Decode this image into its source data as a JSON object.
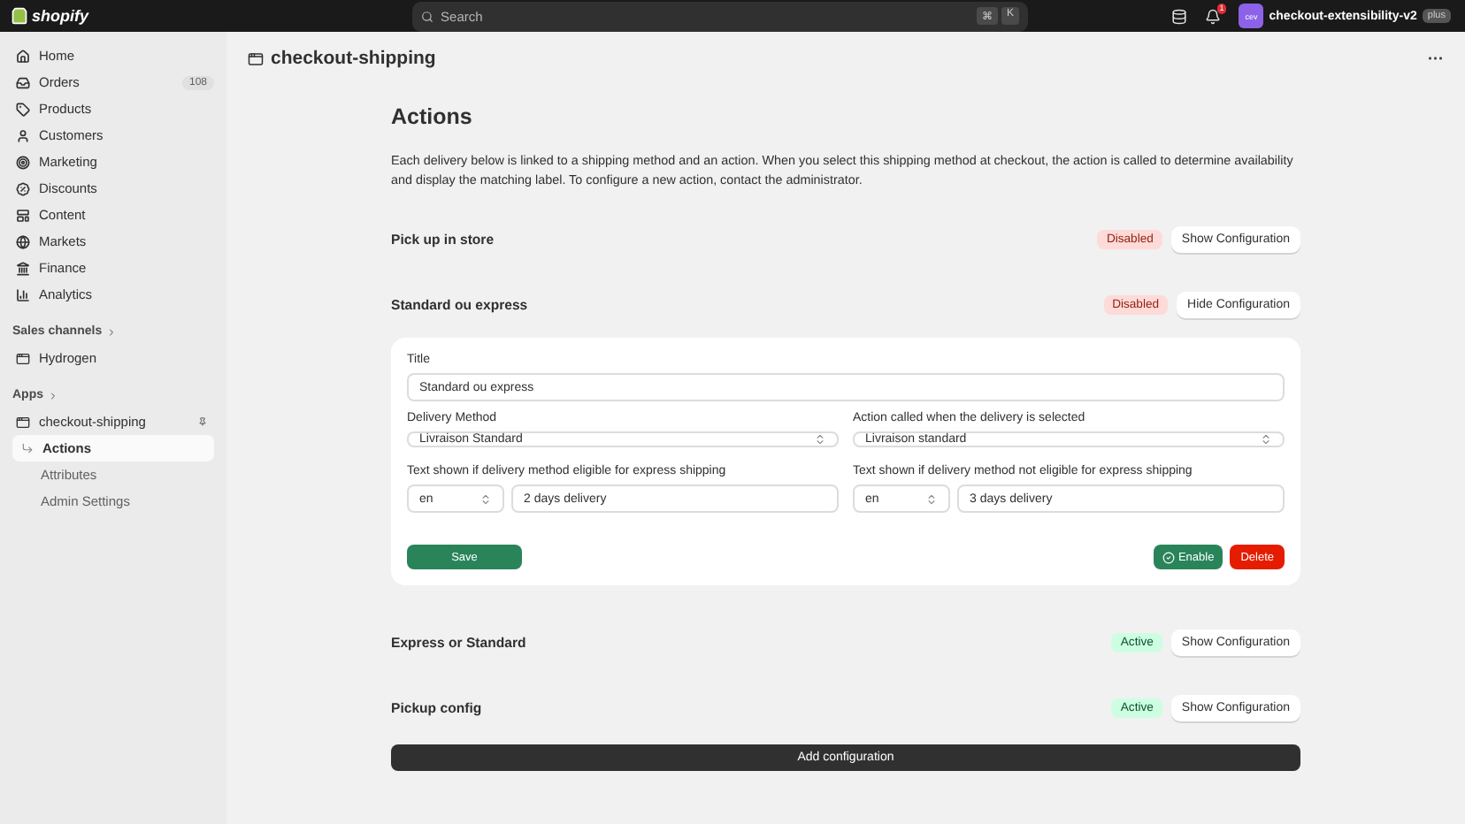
{
  "topbar": {
    "logo": "shopify",
    "search": {
      "placeholder": "Search",
      "shortcut": [
        "⌘",
        "K"
      ]
    },
    "notifications": "1",
    "store": {
      "avatar": "cev",
      "name": "checkout-extensibility-v2",
      "plan": "plus"
    }
  },
  "sidebar": {
    "items": [
      {
        "label": "Home"
      },
      {
        "label": "Orders",
        "count": "108"
      },
      {
        "label": "Products"
      },
      {
        "label": "Customers"
      },
      {
        "label": "Marketing"
      },
      {
        "label": "Discounts"
      },
      {
        "label": "Content"
      },
      {
        "label": "Markets"
      },
      {
        "label": "Finance"
      },
      {
        "label": "Analytics"
      }
    ],
    "sales_channels": {
      "heading": "Sales channels",
      "items": [
        {
          "label": "Hydrogen"
        }
      ]
    },
    "apps": {
      "heading": "Apps",
      "items": [
        {
          "label": "checkout-shipping",
          "children": [
            {
              "label": "Actions",
              "selected": true
            },
            {
              "label": "Attributes",
              "selected": false
            },
            {
              "label": "Admin Settings",
              "selected": false
            }
          ]
        }
      ]
    }
  },
  "header": {
    "title": "checkout-shipping",
    "menu": "···"
  },
  "page": {
    "title": "Actions",
    "description": "Each delivery below is linked to a shipping method and an action. When you select this shipping method at checkout, the action is called to determine availability and display the matching label. To configure a new action, contact the administrator.",
    "configurations": [
      {
        "title": "Pick up in store",
        "kind": "disabled",
        "status_label": "Disabled",
        "button": "Show Configuration"
      },
      {
        "title": "Standard ou express",
        "kind": "disabled",
        "status_label": "Disabled",
        "button": "Hide Configuration",
        "form": {
          "title_field": {
            "label": "Title",
            "value": "Standard ou express"
          },
          "delivery_method": {
            "label": "Delivery Method",
            "value": "Livraison Standard"
          },
          "action": {
            "label": "Action called when the delivery is selected",
            "value": "Livraison standard"
          },
          "express_text": {
            "label": "Text shown if delivery method eligible for express shipping",
            "language": "en",
            "value": "2 days delivery"
          },
          "standard_text": {
            "label": "Text shown if delivery method not eligible for express shipping",
            "language": "en",
            "value": "3 days delivery"
          },
          "save": "Save",
          "enable": "Enable",
          "delete": "Delete"
        }
      },
      {
        "title": "Express or Standard",
        "kind": "active",
        "status_label": "Active",
        "button": "Show Configuration"
      },
      {
        "title": "Pickup config",
        "kind": "active",
        "status_label": "Active",
        "button": "Show Configuration"
      }
    ],
    "add_button": "Add configuration"
  }
}
